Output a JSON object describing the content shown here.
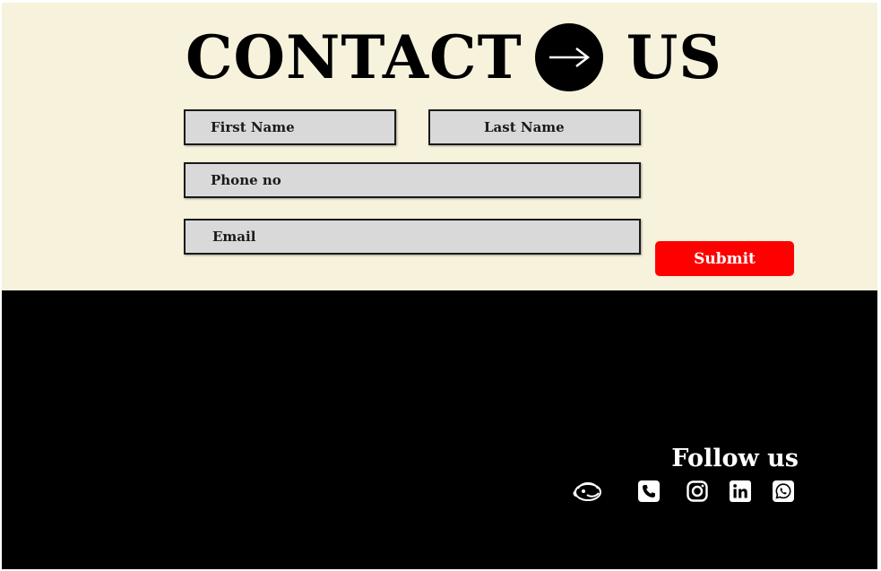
{
  "header": {
    "title_left": "CONTACT",
    "title_right": "US",
    "arrow_icon": "arrow-right-icon"
  },
  "form": {
    "first_name_placeholder": "First Name",
    "last_name_placeholder": "Last Name",
    "phone_placeholder": "Phone no",
    "email_placeholder": "Email",
    "submit_label": "Submit"
  },
  "footer": {
    "follow_label": "Follow us",
    "social_icons": [
      "mailchimp-icon",
      "phone-icon",
      "instagram-icon",
      "linkedin-icon",
      "whatsapp-icon"
    ]
  },
  "colors": {
    "contact_background": "#f6f2dc",
    "footer_background": "#000000",
    "field_background": "#d9d9d9",
    "submit_background": "#ff0000",
    "text": "#000000"
  }
}
